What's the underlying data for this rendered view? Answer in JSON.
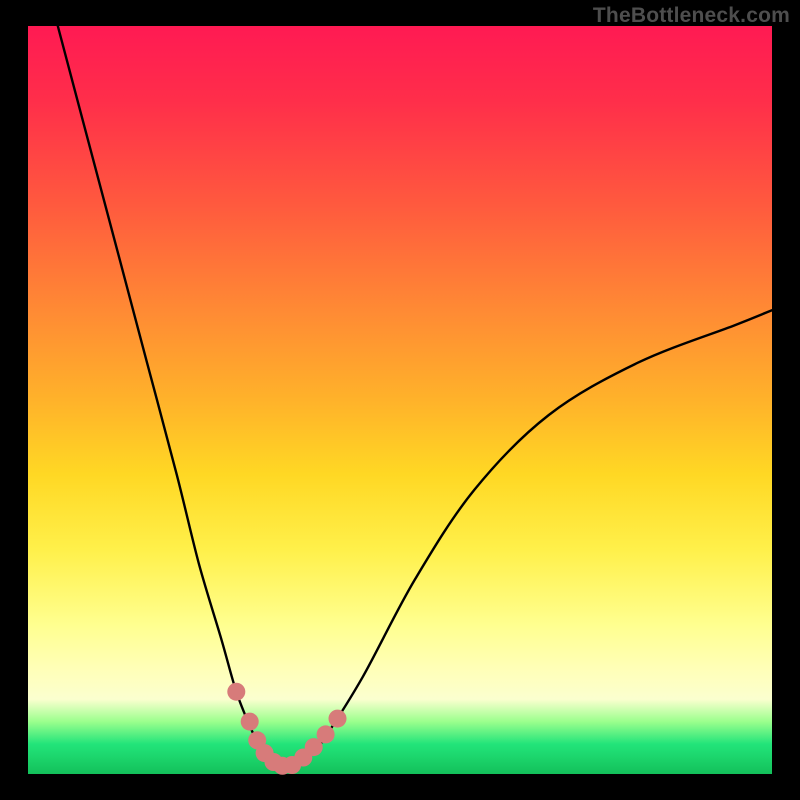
{
  "watermark": "TheBottleneck.com",
  "chart_data": {
    "type": "line",
    "title": "",
    "xlabel": "",
    "ylabel": "",
    "xlim": [
      0,
      100
    ],
    "ylim": [
      0,
      100
    ],
    "grid": false,
    "series": [
      {
        "name": "curve",
        "color": "#000000",
        "x": [
          4,
          8,
          12,
          16,
          20,
          23,
          26,
          28,
          30,
          31.5,
          33,
          34.5,
          36,
          38,
          40,
          45,
          52,
          60,
          70,
          82,
          95,
          100
        ],
        "y": [
          100,
          85,
          70,
          55,
          40,
          28,
          18,
          11,
          6,
          3,
          1.5,
          1,
          1.2,
          2.5,
          5,
          13,
          26,
          38,
          48,
          55,
          60,
          62
        ]
      }
    ],
    "markers": {
      "name": "highlight-dots",
      "color": "#d77b7a",
      "points": [
        {
          "x": 28.0,
          "y": 11.0
        },
        {
          "x": 29.8,
          "y": 7.0
        },
        {
          "x": 30.8,
          "y": 4.5
        },
        {
          "x": 31.8,
          "y": 2.8
        },
        {
          "x": 33.0,
          "y": 1.6
        },
        {
          "x": 34.2,
          "y": 1.1
        },
        {
          "x": 35.5,
          "y": 1.2
        },
        {
          "x": 37.0,
          "y": 2.2
        },
        {
          "x": 38.4,
          "y": 3.6
        },
        {
          "x": 40.0,
          "y": 5.3
        },
        {
          "x": 41.6,
          "y": 7.4
        }
      ]
    }
  }
}
